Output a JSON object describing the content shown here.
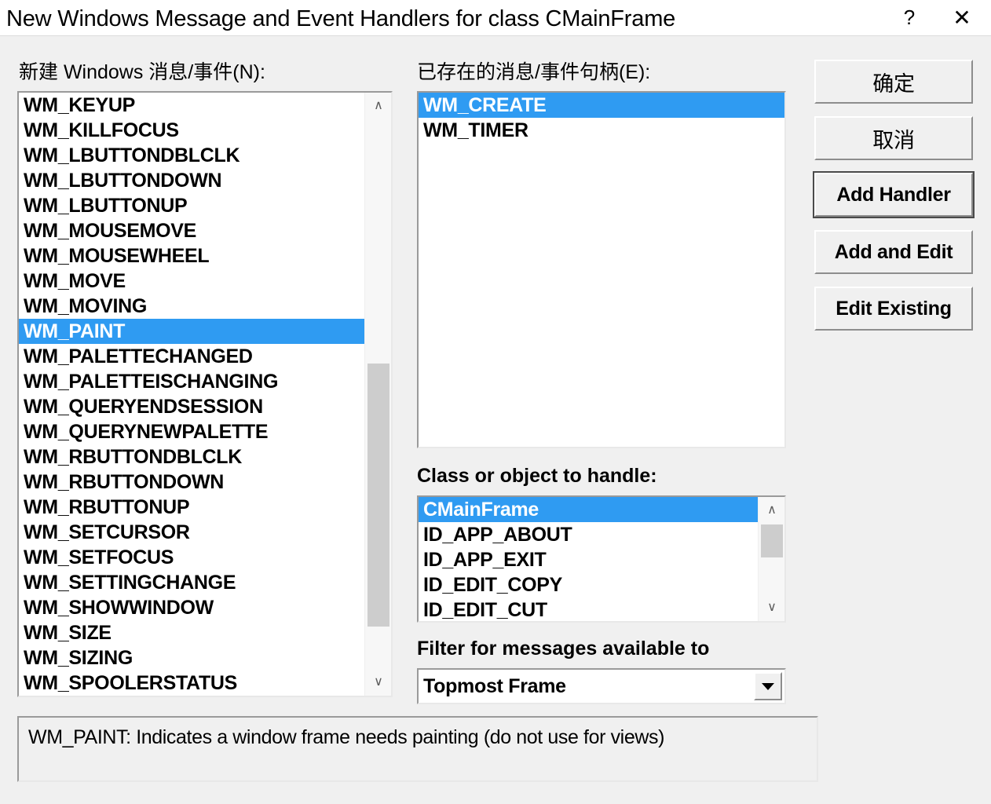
{
  "window": {
    "title": "New Windows Message and Event Handlers for class CMainFrame",
    "help_glyph": "?",
    "close_glyph": "✕"
  },
  "new_messages": {
    "label": "新建 Windows 消息/事件(N):",
    "selected": "WM_PAINT",
    "items": [
      "WM_KEYUP",
      "WM_KILLFOCUS",
      "WM_LBUTTONDBLCLK",
      "WM_LBUTTONDOWN",
      "WM_LBUTTONUP",
      "WM_MOUSEMOVE",
      "WM_MOUSEWHEEL",
      "WM_MOVE",
      "WM_MOVING",
      "WM_PAINT",
      "WM_PALETTECHANGED",
      "WM_PALETTEISCHANGING",
      "WM_QUERYENDSESSION",
      "WM_QUERYNEWPALETTE",
      "WM_RBUTTONDBLCLK",
      "WM_RBUTTONDOWN",
      "WM_RBUTTONUP",
      "WM_SETCURSOR",
      "WM_SETFOCUS",
      "WM_SETTINGCHANGE",
      "WM_SHOWWINDOW",
      "WM_SIZE",
      "WM_SIZING",
      "WM_SPOOLERSTATUS"
    ],
    "scroll": {
      "up_glyph": "∧",
      "down_glyph": "∨"
    }
  },
  "existing_handlers": {
    "label": "已存在的消息/事件句柄(E):",
    "selected": "WM_CREATE",
    "items": [
      "WM_CREATE",
      "WM_TIMER"
    ]
  },
  "class_or_object": {
    "label": "Class or object to handle:",
    "selected": "CMainFrame",
    "items": [
      "CMainFrame",
      "ID_APP_ABOUT",
      "ID_APP_EXIT",
      "ID_EDIT_COPY",
      "ID_EDIT_CUT"
    ],
    "scroll": {
      "up_glyph": "∧",
      "down_glyph": "∨"
    }
  },
  "filter": {
    "label": "Filter for messages available to",
    "value": "Topmost Frame"
  },
  "buttons": {
    "ok": "确定",
    "cancel": "取消",
    "add_handler": "Add Handler",
    "add_and_edit": "Add and Edit",
    "edit_existing": "Edit Existing"
  },
  "description": {
    "text": "WM_PAINT:  Indicates a window frame needs painting (do not use for views)"
  },
  "colors": {
    "selection": "#2f9bf2",
    "dialog_background": "#f0f0f0",
    "titlebar_background": "#ffffff",
    "scroll_thumb": "#cdcdcd"
  }
}
